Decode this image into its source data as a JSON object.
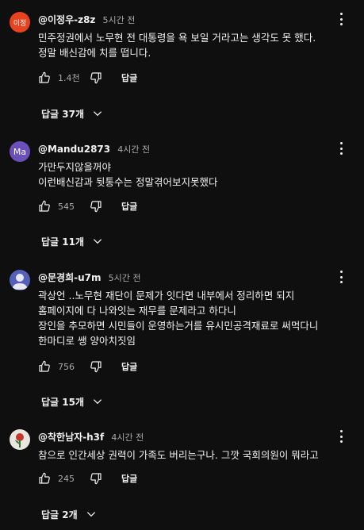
{
  "comments": [
    {
      "author": "@이정우-z8z",
      "time": "5시간 전",
      "avatar_text": "이정",
      "avatar_color": "#e8431f",
      "lines": [
        "민주정권에서 노무현 전 대통령을 욕 보일 거라고는 생각도 못 했다.",
        "정말 배신감에 치를 떱니다."
      ],
      "likes": "1.4천",
      "reply_label": "답글",
      "replies": "답글 37개"
    },
    {
      "author": "@Mandu2873",
      "time": "4시간 전",
      "avatar_text": "Ma",
      "avatar_color": "#6b4fbb",
      "lines": [
        "가만두지않을꺼야",
        "이런배신감과 뒷통수는 정말겪어보지못했다"
      ],
      "likes": "545",
      "reply_label": "답글",
      "replies": "답글 11개"
    },
    {
      "author": "@문경희-u7m",
      "time": "5시간 전",
      "avatar_text": "",
      "avatar_color": "#5561b8",
      "lines": [
        "곽상언 ..노무현 재단이 문제가 잇다면  내부에서 정리하면 되지",
        "홈페이지에 다 나와잇는 재무를   문제라고 하다니",
        "장인을 추모하면 시민들이 운영하는거를  유시민공격재료로 써먹다니",
        "한마디로 쌩 양아치짓임"
      ],
      "likes": "756",
      "reply_label": "답글",
      "replies": "답글 15개"
    },
    {
      "author": "@착한남자-h3f",
      "time": "4시간 전",
      "avatar_text": "",
      "avatar_color": "#e9e6e0",
      "lines": [
        "참으로 인간세상 권력이 가족도 버리는구나.  그깟 국회의원이 뭐라고"
      ],
      "likes": "245",
      "reply_label": "답글",
      "replies": "답글 2개"
    }
  ]
}
